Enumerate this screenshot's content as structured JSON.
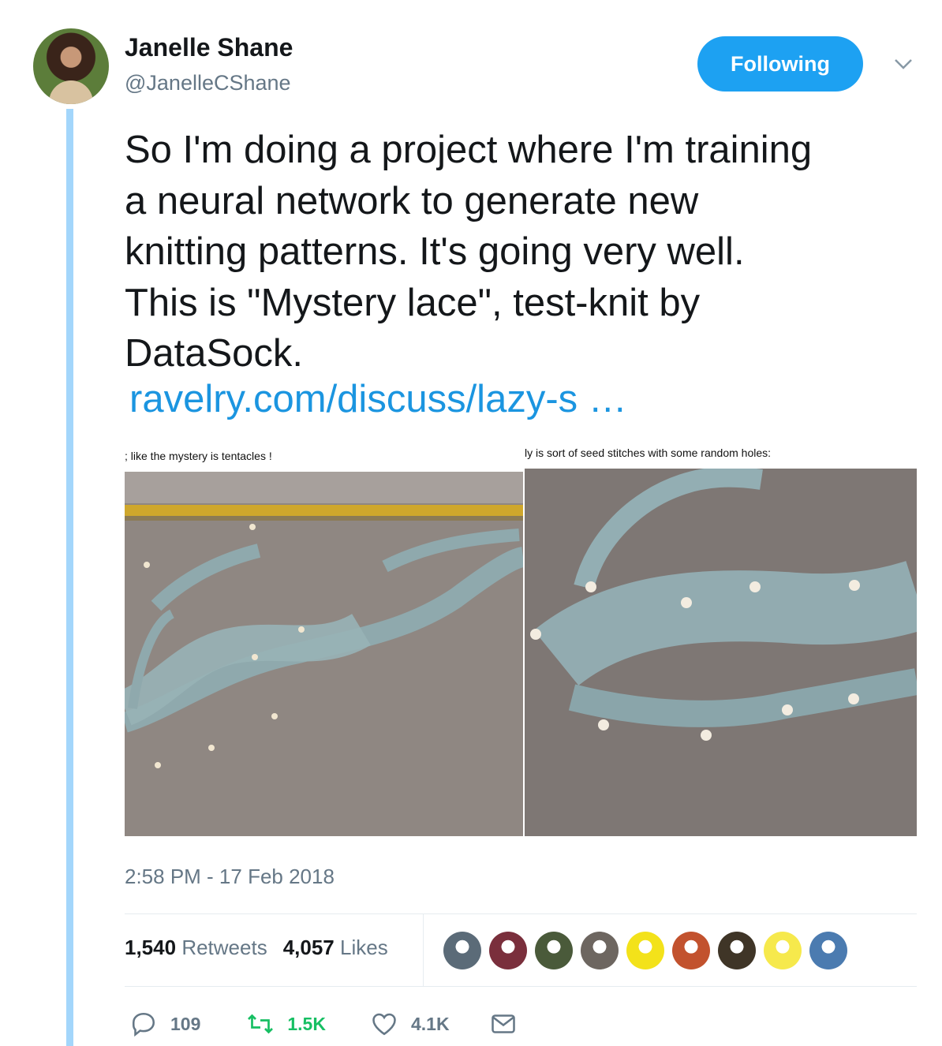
{
  "author": {
    "name": "Janelle Shane",
    "handle": "@JanelleCShane",
    "follow_label": "Following"
  },
  "tweet": {
    "text_lines": [
      "So I'm doing a project where I'm training",
      "a neural network to generate new",
      "knitting patterns. It's going very well.",
      "This is \"Mystery lace\", test-knit by",
      "DataSock."
    ],
    "link_text": "ravelry.com/discuss/lazy-s  …",
    "media": [
      {
        "caption": "; like the mystery is tentacles !"
      },
      {
        "caption": "ly is sort of seed stitches with some random holes:"
      }
    ],
    "timestamp": "2:58 PM - 17 Feb 2018"
  },
  "stats": {
    "retweets_count": "1,540",
    "retweets_label": "Retweets",
    "likes_count": "4,057",
    "likes_label": "Likes"
  },
  "likers": [
    {
      "color": "#5b6b78"
    },
    {
      "color": "#7a2f3c"
    },
    {
      "color": "#4a5a3a"
    },
    {
      "color": "#6d6660"
    },
    {
      "color": "#f3e21a"
    },
    {
      "color": "#c2522e"
    },
    {
      "color": "#3f3527"
    },
    {
      "color": "#f6e94c"
    },
    {
      "color": "#4b7bb0"
    }
  ],
  "actions": {
    "reply_count": "109",
    "retweet_count": "1.5K",
    "like_count": "4.1K"
  },
  "colors": {
    "accent": "#1da1f2",
    "link": "#1b95e0",
    "retweet_green": "#17bf63",
    "thread_line": "#a3d6fb",
    "muted": "#657786"
  }
}
